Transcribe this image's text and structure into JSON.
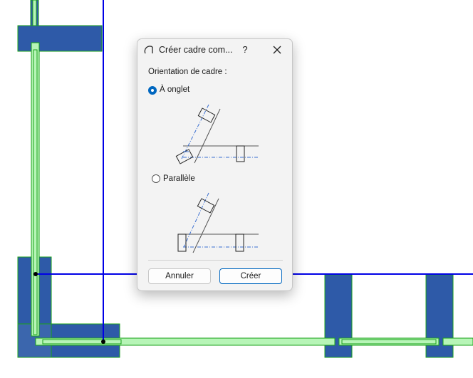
{
  "dialog": {
    "title": "Créer cadre com...",
    "help_label": "?",
    "section_label": "Orientation de cadre :",
    "options": [
      {
        "label": "À onglet",
        "selected": true
      },
      {
        "label": "Parallèle",
        "selected": false
      }
    ],
    "cancel_label": "Annuler",
    "create_label": "Créer"
  },
  "colors": {
    "accent": "#0067c0",
    "wall_fill": "#2e5aa8",
    "frame_fill": "#b7f5b7",
    "frame_edge": "#1aa11a",
    "guide_line": "#0000e6"
  },
  "icons": {
    "title": "frame-arc-icon",
    "close": "close-icon"
  }
}
